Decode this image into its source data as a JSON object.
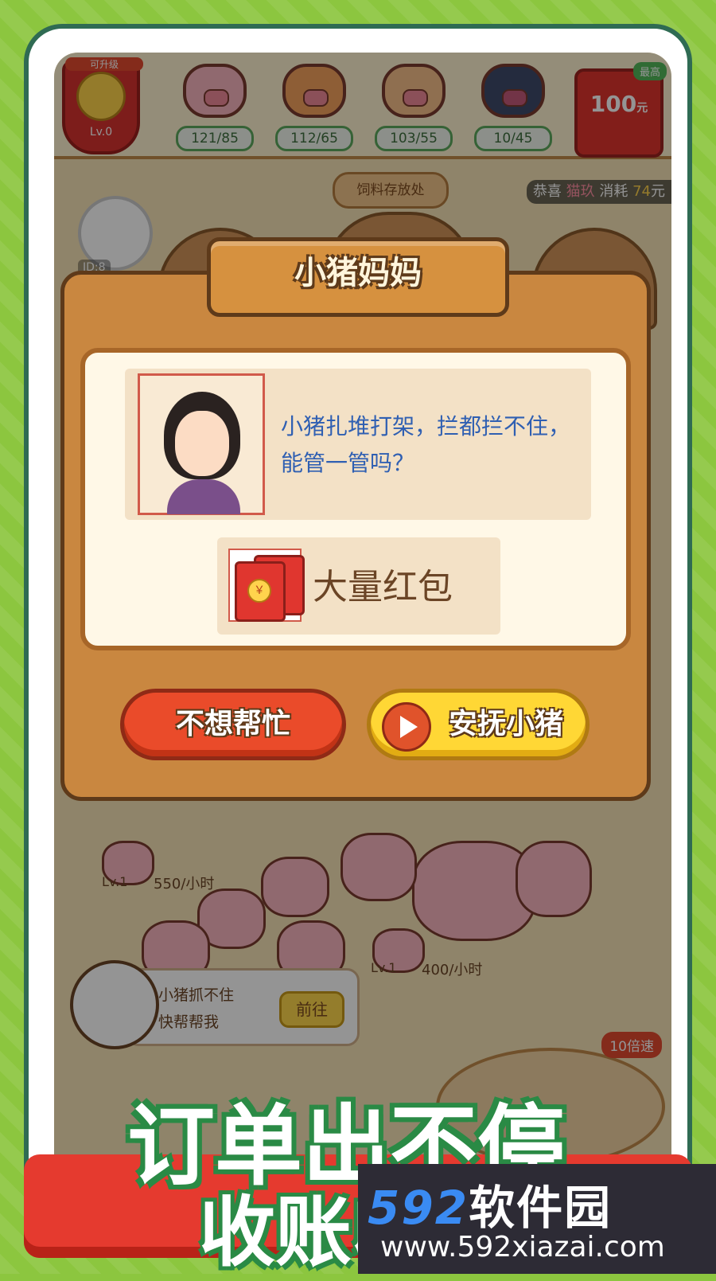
{
  "topbar": {
    "upgrade_tag": "可升级",
    "level": "Lv.0",
    "pigs": [
      {
        "count": "121/85"
      },
      {
        "count": "112/65"
      },
      {
        "count": "103/55"
      },
      {
        "count": "10/45"
      }
    ],
    "redpack": {
      "best": "最高",
      "amount": "100",
      "unit": "元"
    }
  },
  "ticker": {
    "prefix": "恭喜",
    "name": "猫玖",
    "action": "消耗",
    "amount": "74",
    "unit": "元"
  },
  "feed_sign": "饲料存放处",
  "player_id": "ID:8",
  "scene": {
    "rate_left": "550/小时",
    "rate_right": "400/小时",
    "lv_left": "Lv.1",
    "lv_right": "Lv.1",
    "speed_badge": "10倍速",
    "bubble": {
      "line1": "小猪抓不住",
      "line2": "快帮帮我",
      "go_label": "前往"
    }
  },
  "dialog": {
    "title": "小猪妈妈",
    "message": "小猪扎堆打架，拦都拦不住，能管一管吗？",
    "reward_coin": "￥",
    "reward_label": "大量红包",
    "decline_label": "不想帮忙",
    "accept_label": "安抚小猪"
  },
  "banner": {
    "line1": "订单出不停",
    "line2": "收账收"
  },
  "watermark": {
    "brand_num": "592",
    "brand_text": "软件园",
    "url": "www.592xiazai.com"
  },
  "colors": {
    "dialog_wood": "#c98740",
    "decline_red": "#ea4b2a",
    "accept_yellow": "#ffd735",
    "message_blue": "#2f5fb2"
  }
}
